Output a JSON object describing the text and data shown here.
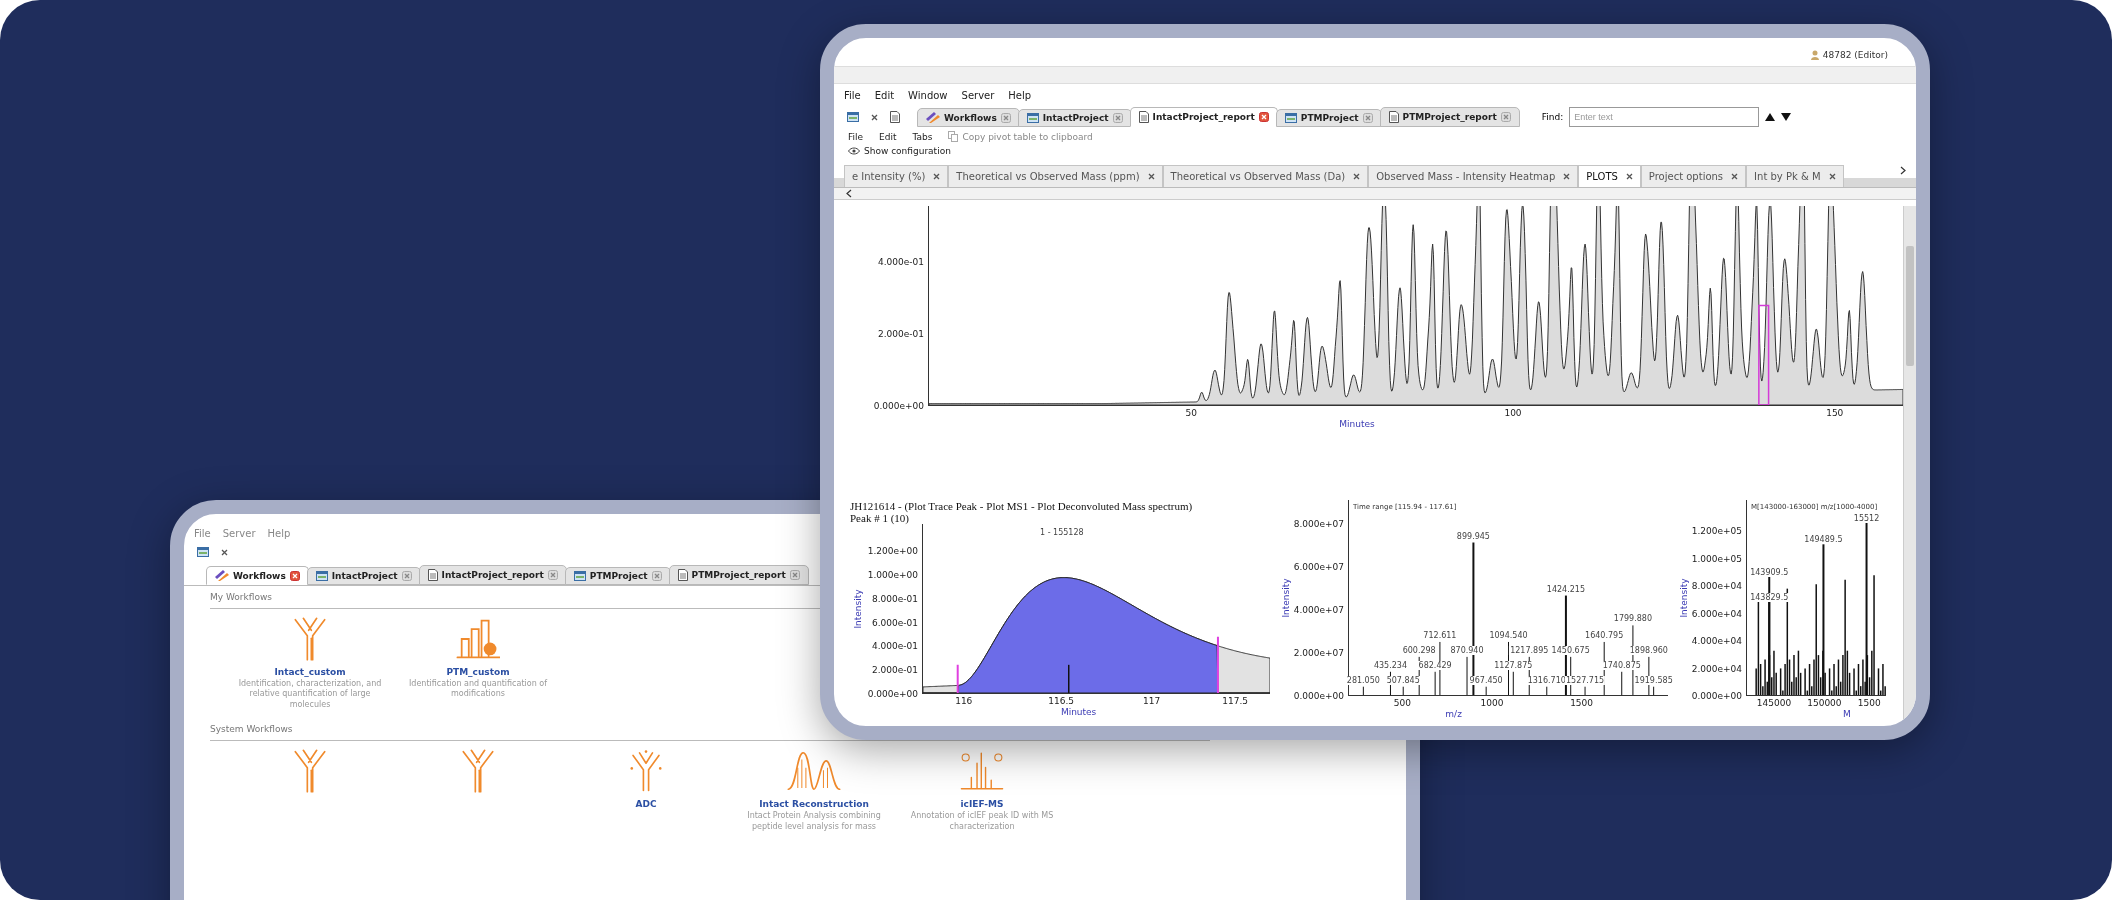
{
  "back_screen": {
    "menu": [
      "File",
      "Server",
      "Help"
    ],
    "tabs": [
      {
        "label": "Workflows",
        "kind": "workflows",
        "selected": true
      },
      {
        "label": "IntactProject",
        "kind": "project",
        "selected": false
      },
      {
        "label": "IntactProject_report",
        "kind": "report",
        "selected": false
      },
      {
        "label": "PTMProject",
        "kind": "project",
        "selected": false
      },
      {
        "label": "PTMProject_report",
        "kind": "report",
        "selected": false
      }
    ],
    "sections": [
      {
        "heading": "My Workflows",
        "cards": [
          {
            "kind": "antibody",
            "title": "Intact_custom",
            "description": "Identification, characterization, and relative quantification of large molecules"
          },
          {
            "kind": "bars",
            "title": "PTM_custom",
            "description": "Identification and quantification of modifications"
          }
        ]
      },
      {
        "heading": "System Workflows",
        "cards": [
          {
            "kind": "antibody"
          },
          {
            "kind": "antibody"
          },
          {
            "kind": "adc",
            "title": "ADC"
          },
          {
            "kind": "peaks",
            "title": "Intact Reconstruction",
            "description": "Intact Protein Analysis combining peptide level analysis for mass"
          },
          {
            "kind": "spectrum",
            "title": "icIEF-MS",
            "description": "Annotation of icIEF peak ID with MS characterization"
          }
        ]
      }
    ]
  },
  "front_screen": {
    "user": "48782 (Editor)",
    "menu": [
      "File",
      "Edit",
      "Window",
      "Server",
      "Help"
    ],
    "project_tabs": [
      {
        "label": "Workflows",
        "kind": "workflows",
        "selected": false
      },
      {
        "label": "IntactProject",
        "kind": "project",
        "selected": false
      },
      {
        "label": "IntactProject_report",
        "kind": "report",
        "selected": true
      },
      {
        "label": "PTMProject",
        "kind": "project",
        "selected": false
      },
      {
        "label": "PTMProject_report",
        "kind": "report",
        "selected": false
      }
    ],
    "find": {
      "label": "Find:",
      "placeholder": "Enter text"
    },
    "report_menu": [
      "File",
      "Edit",
      "Tabs"
    ],
    "copy_action": "Copy pivot table to clipboard",
    "config_action": "Show configuration",
    "report_tabs": [
      {
        "label": "e Intensity (%)",
        "selected": false
      },
      {
        "label": "Theoretical vs Observed Mass (ppm)",
        "selected": false
      },
      {
        "label": "Theoretical vs Observed Mass (Da)",
        "selected": false
      },
      {
        "label": "Observed Mass - Intensity Heatmap",
        "selected": false
      },
      {
        "label": "PLOTS",
        "selected": true
      },
      {
        "label": "Project options",
        "selected": false
      },
      {
        "label": "Int by Pk & M",
        "selected": false
      }
    ],
    "main_plot": {
      "yticks": [
        "4.000e-01",
        "2.000e-01",
        "0.000e+00"
      ],
      "xticks": [
        "50",
        "100",
        "150"
      ],
      "xlabel": "Minutes"
    },
    "trace_plot": {
      "title": "JH121614 - (Plot Trace Peak - Plot MS1 - Plot Deconvoluted Mass spectrum)",
      "subtitle": "Peak # 1 (10)",
      "peak_label": "1 - 155128",
      "ylabel": "Intensity",
      "yticks": [
        "1.200e+00",
        "1.000e+00",
        "8.000e-01",
        "6.000e-01",
        "4.000e-01",
        "2.000e-01",
        "0.000e+00"
      ],
      "xticks": [
        "116",
        "116.5",
        "117",
        "117.5"
      ],
      "xlabel": "Minutes"
    },
    "ms1_plot": {
      "title": "Time range [115.94 - 117.61]",
      "ylabel": "Intensity",
      "yticks": [
        "8.000e+07",
        "6.000e+07",
        "4.000e+07",
        "2.000e+07",
        "0.000e+00"
      ],
      "xticks": [
        "500",
        "1000",
        "1500"
      ],
      "xlabel": "m/z",
      "peak_labels": [
        "899.945",
        "1424.215",
        "1799.880",
        "712.611",
        "1094.540",
        "1640.795",
        "600.298",
        "870.940",
        "1217.895",
        "1450.675",
        "1898.960",
        "435.234",
        "682.429",
        "1127.875",
        "1740.875",
        "281.050",
        "507.845",
        "967.450",
        "1316.710",
        "1527.715",
        "1919.585"
      ]
    },
    "deconv_plot": {
      "title": "M[143000-163000] m/z[1000-4000]",
      "ylabel": "Intensity",
      "yticks": [
        "1.200e+05",
        "1.000e+05",
        "8.000e+04",
        "6.000e+04",
        "4.000e+04",
        "2.000e+04",
        "0.000e+00"
      ],
      "xticks": [
        "145000",
        "150000",
        "1500"
      ],
      "xlabel": "M",
      "peak_labels": [
        "15512",
        "149489.5",
        "143909.5",
        "143829.5"
      ]
    }
  }
}
